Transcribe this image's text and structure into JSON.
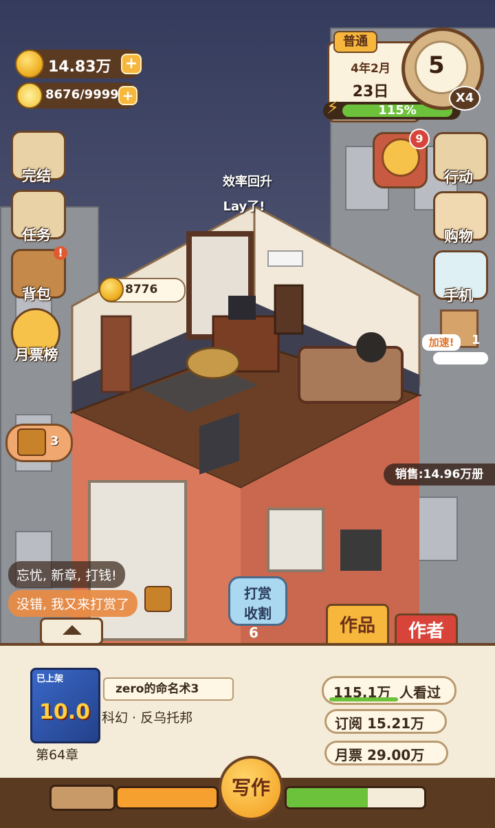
{
  "resources": {
    "coins": "14.83万",
    "energy": "8676/9999"
  },
  "date": {
    "difficulty": "普通",
    "year_month": "4年2月",
    "day": "23日",
    "progress_label": "115%",
    "progress": 1.0,
    "hand_count": "5",
    "speed": "X4"
  },
  "left_menu": [
    {
      "label": "完结",
      "icon": "book-icon"
    },
    {
      "label": "任务",
      "icon": "clipboard-icon"
    },
    {
      "label": "背包",
      "icon": "backpack-icon"
    },
    {
      "label": "月票榜",
      "icon": "ticket-icon"
    }
  ],
  "right_menu": [
    {
      "label": "行动",
      "icon": "door-icon"
    },
    {
      "label": "购物",
      "icon": "shop-icon"
    },
    {
      "label": "手机",
      "icon": "phone-icon"
    }
  ],
  "wheel": {
    "badge": "9",
    "icon": "fortune-wheel-icon"
  },
  "speedup": {
    "label": "加速!",
    "count": "1"
  },
  "floating": {
    "line1": "效率回升",
    "line2": "Lay了!"
  },
  "room_coins": "8776",
  "treasure_count": "3",
  "sales": "销售:14.96万册",
  "chats": [
    "忘忧, 新章, 打钱!",
    "没错, 我又来打赏了"
  ],
  "tip_button": {
    "label_line1": "打赏",
    "label_line2": "收割",
    "count": "6"
  },
  "tabs": {
    "works": "作品",
    "author": "作者"
  },
  "book": {
    "cover_tag": "已上架",
    "cover_score": "10.0",
    "title": "zero的命名术3",
    "genre": "科幻 · 反乌托邦",
    "chapter": "第64章",
    "views": "115.1万",
    "views_label": "人看过",
    "subscribe": "订阅 15.21万",
    "monthly": "月票 29.00万"
  },
  "write_button": "写作",
  "colors": {
    "accent": "#f6b73c",
    "panel": "#f4ecd9",
    "brown": "#6b4324",
    "red": "#d8443a",
    "green": "#6cc23a"
  }
}
